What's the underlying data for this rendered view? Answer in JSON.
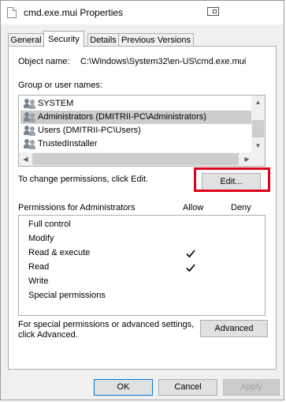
{
  "window": {
    "title": "cmd.exe.mui Properties"
  },
  "tabs": [
    {
      "label": "General"
    },
    {
      "label": "Security"
    },
    {
      "label": "Details"
    },
    {
      "label": "Previous Versions"
    }
  ],
  "security": {
    "object_name_label": "Object name:",
    "object_name_value": "C:\\Windows\\System32\\en-US\\cmd.exe.mui",
    "group_label": "Group or user names:",
    "users": [
      {
        "name": "SYSTEM",
        "selected": false
      },
      {
        "name": "Administrators (DMITRII-PC\\Administrators)",
        "selected": true
      },
      {
        "name": "Users (DMITRII-PC\\Users)",
        "selected": false
      },
      {
        "name": "TrustedInstaller",
        "selected": false
      }
    ],
    "change_text": "To change permissions, click Edit.",
    "edit_button": "Edit...",
    "permissions_for_label": "Permissions for Administrators",
    "allow_header": "Allow",
    "deny_header": "Deny",
    "permissions": [
      {
        "name": "Full control",
        "allow": false,
        "deny": false
      },
      {
        "name": "Modify",
        "allow": false,
        "deny": false
      },
      {
        "name": "Read & execute",
        "allow": true,
        "deny": false
      },
      {
        "name": "Read",
        "allow": true,
        "deny": false
      },
      {
        "name": "Write",
        "allow": false,
        "deny": false
      },
      {
        "name": "Special permissions",
        "allow": false,
        "deny": false
      }
    ],
    "advanced_text_line1": "For special permissions or advanced settings,",
    "advanced_text_line2": "click Advanced.",
    "advanced_button": "Advanced"
  },
  "footer": {
    "ok": "OK",
    "cancel": "Cancel",
    "apply": "Apply"
  },
  "colors": {
    "highlight": "#e0001a",
    "selected_row": "#cccccc",
    "default_button_border": "#0078d7"
  },
  "icons": {
    "user": "user-group-icon",
    "check": "checkmark-icon"
  }
}
